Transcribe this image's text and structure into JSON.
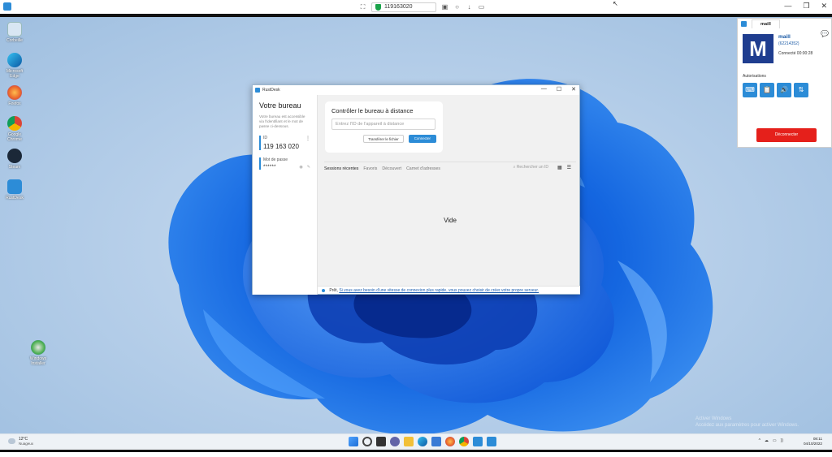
{
  "toolbar": {
    "remote_id": "119163020",
    "icons": [
      "display-icon",
      "chat-icon",
      "mic-icon",
      "monitor-icon"
    ],
    "window_controls": [
      "minimize-icon",
      "restore-icon",
      "close-icon"
    ]
  },
  "desktop": {
    "icons": [
      {
        "label": "Corbeille",
        "icon": "recycle-bin-icon",
        "color": "#7aa7cf"
      },
      {
        "label": "Microsoft Edge",
        "icon": "edge-icon",
        "color": "#1e9bd7"
      },
      {
        "label": "Firefox",
        "icon": "firefox-icon",
        "color": "#e8622b"
      },
      {
        "label": "Google Chrome",
        "icon": "chrome-icon",
        "color": "#db4437"
      },
      {
        "label": "Steam",
        "icon": "steam-icon",
        "color": "#1b2838"
      },
      {
        "label": "RustDesk",
        "icon": "rustdesk-icon",
        "color": "#2c8cd7"
      },
      {
        "label": "Windows Installer",
        "icon": "installer-icon",
        "color": "#4caf50"
      }
    ],
    "watermark_line1": "Activer Windows",
    "watermark_line2": "Accédez aux paramètres pour activer Windows."
  },
  "rustdesk": {
    "title": "RustDesk",
    "sidebar": {
      "heading": "Votre bureau",
      "description": "Votre bureau est accessible via l'identifiant et le mot de passe ci-dessous.",
      "id_label": "ID",
      "id_value": "119 163 020",
      "password_label": "Mot de passe",
      "password_value": "******"
    },
    "connect_card": {
      "heading": "Contrôler le bureau à distance",
      "input_placeholder": "Entrez l'ID de l'appareil à distance",
      "transfer_button": "Transférer le fichier",
      "connect_button": "Connecter"
    },
    "tabs": [
      "Sessions récentes",
      "Favoris",
      "Découvert",
      "Carnet d'adresses"
    ],
    "active_tab": "Sessions récentes",
    "search_placeholder": "Rechercher un ID",
    "empty_label": "Vide",
    "status": {
      "ready": "Prêt,",
      "message": "Si vous avez besoin d'une vitesse de connexion plus rapide, vous pouvez choisir de créer votre propre serveur."
    }
  },
  "connection_panel": {
    "tab_label": "maill",
    "avatar_letter": "M",
    "user_name": "maill",
    "user_id": "(62214352)",
    "connected_label": "Connecté 00:00:28",
    "permissions_label": "Autorisations",
    "permission_icons": [
      "keyboard-icon",
      "clipboard-icon",
      "audio-icon",
      "file-transfer-icon"
    ],
    "disconnect_button": "Déconnecter",
    "accent_color": "#2c8cd7",
    "disconnect_color": "#e5201b"
  },
  "taskbar": {
    "temperature": "12°C",
    "weather": "Nuageux",
    "clock_time": "08:11",
    "clock_date": "04/10/2022",
    "apps": [
      {
        "icon": "windows-start-icon",
        "color": "#1f6fd6"
      },
      {
        "icon": "search-icon",
        "color": "#444444"
      },
      {
        "icon": "task-view-icon",
        "color": "#333333"
      },
      {
        "icon": "chat-icon",
        "color": "#6264a7"
      },
      {
        "icon": "file-explorer-icon",
        "color": "#f2c037"
      },
      {
        "icon": "edge-icon",
        "color": "#1e9bd7"
      },
      {
        "icon": "store-icon",
        "color": "#3a7bd5"
      },
      {
        "icon": "firefox-icon",
        "color": "#e8622b"
      },
      {
        "icon": "chrome-icon",
        "color": "#db4437"
      },
      {
        "icon": "rustdesk-icon",
        "color": "#2c8cd7"
      },
      {
        "icon": "rustdesk-icon",
        "color": "#2c8cd7"
      }
    ],
    "tray_items": [
      "^",
      "☁",
      "▭",
      "))",
      "🔋"
    ]
  }
}
